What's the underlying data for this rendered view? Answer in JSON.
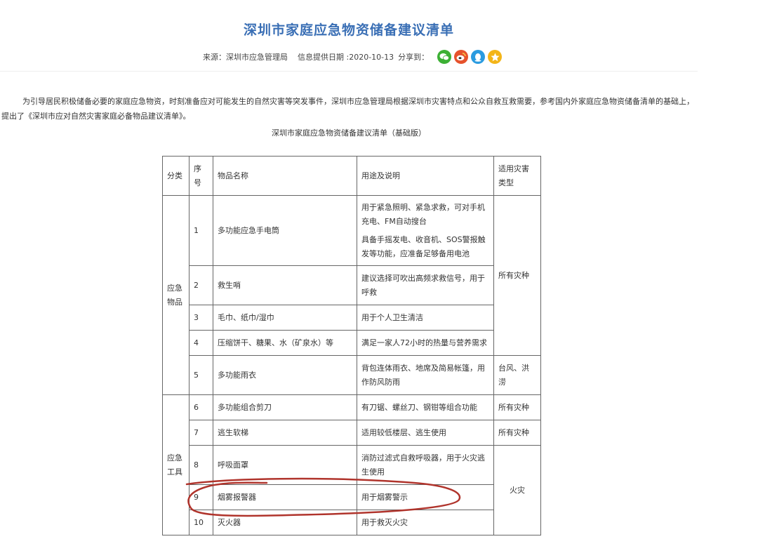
{
  "article": {
    "title": "深圳市家庭应急物资储备建议清单",
    "source": "来源：深圳市应急管理局",
    "date": "信息提供日期 :2020-10-13",
    "share_label": "分享到：",
    "share_icons": [
      "wechat-icon",
      "weibo-icon",
      "qq-icon",
      "qzone-icon"
    ],
    "intro": "为引导居民积极储备必要的家庭应急物资，时刻准备应对可能发生的自然灾害等突发事件，深圳市应急管理局根据深圳市灾害特点和公众自救互救需要，参考国内外家庭应急物资储备清单的基础上，提出了《深圳市应对自然灾害家庭必备物品建议清单》。",
    "table_title": "深圳市家庭应急物资储备建议清单（基础版）"
  },
  "table": {
    "headers": {
      "category": "分类",
      "number": "序号",
      "item": "物品名称",
      "usage": "用途及说明",
      "disaster": "适用灾害类型"
    },
    "category_1": "应急物品",
    "category_2": "应急工具",
    "rows": [
      {
        "no": "1",
        "item": "多功能应急手电筒",
        "usage": [
          "用于紧急照明、紧急求救，可对手机充电、FM自动搜台",
          "具备手摇发电、收音机、SOS警报触发等功能，应准备足够备用电池"
        ]
      },
      {
        "no": "2",
        "item": "救生哨",
        "usage": [
          "建议选择可吹出高频求救信号，用于呼救"
        ]
      },
      {
        "no": "3",
        "item": "毛巾、纸巾/湿巾",
        "usage": [
          "用于个人卫生清洁"
        ]
      },
      {
        "no": "4",
        "item": "压缩饼干、糖果、水（矿泉水）等",
        "usage": [
          "满足一家人72小时的热量与营养需求"
        ]
      },
      {
        "no": "5",
        "item": "多功能雨衣",
        "usage": [
          "背包连体雨衣、地席及简易帐篷，用作防风防雨"
        ]
      },
      {
        "no": "6",
        "item": "多功能组合剪刀",
        "usage": [
          "有刀锯、螺丝刀、钢钳等组合功能"
        ]
      },
      {
        "no": "7",
        "item": "逃生软梯",
        "usage": [
          "适用较低楼层、逃生使用"
        ]
      },
      {
        "no": "8",
        "item": "呼吸面罩",
        "usage": [
          "消防过滤式自救呼吸器，用于火灾逃生使用"
        ]
      },
      {
        "no": "9",
        "item": "烟雾报警器",
        "usage": [
          "用于烟雾警示"
        ]
      },
      {
        "no": "10",
        "item": "灭火器",
        "usage": [
          "用于救灭火灾"
        ]
      }
    ],
    "disaster_all": "所有灾种",
    "disaster_typhoon": "台风、洪涝",
    "disaster_6": "所有灾种",
    "disaster_7": "所有灾种",
    "disaster_fire": "火灾"
  },
  "colors": {
    "title": "#3a6fb5",
    "wechat": "#3cb034",
    "weibo": "#e6522c",
    "qq": "#2a9be0",
    "qzone": "#f3b518",
    "annotation": "#b0342c"
  }
}
